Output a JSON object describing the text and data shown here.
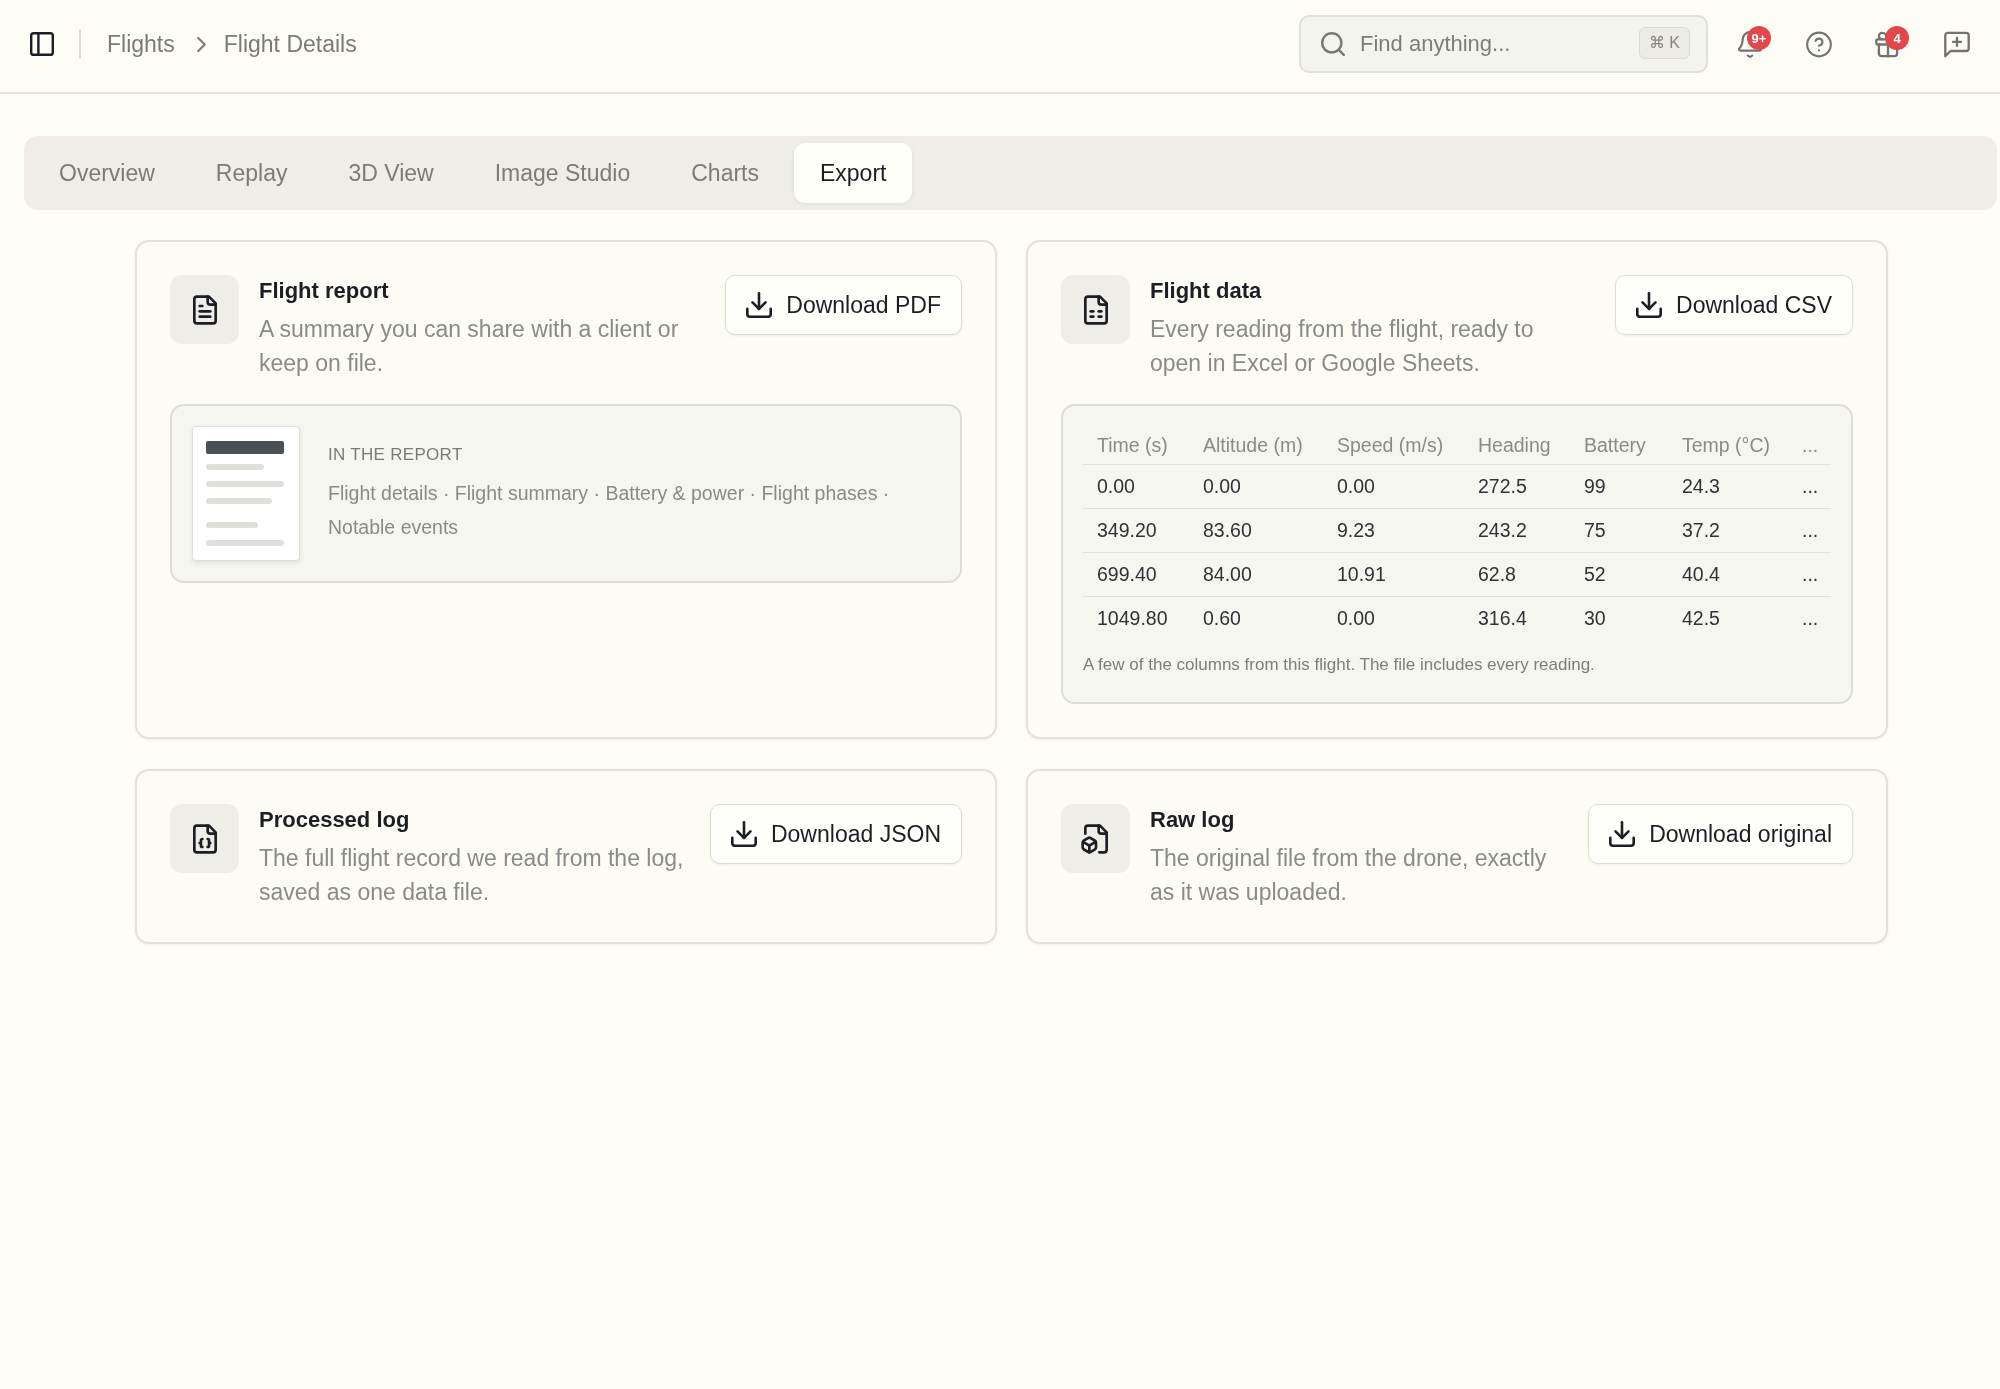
{
  "topbar": {
    "breadcrumb": [
      "Flights",
      "Flight Details"
    ],
    "search": {
      "placeholder": "Find anything...",
      "shortcut": "⌘ K"
    },
    "actions": [
      {
        "kind": "notifications",
        "badge": "9+"
      },
      {
        "kind": "help"
      },
      {
        "kind": "gifts",
        "badge": "4"
      },
      {
        "kind": "feedback"
      }
    ]
  },
  "tabs": [
    {
      "label": "Overview",
      "selected": false
    },
    {
      "label": "Replay",
      "selected": false
    },
    {
      "label": "3D View",
      "selected": false
    },
    {
      "label": "Image Studio",
      "selected": false
    },
    {
      "label": "Charts",
      "selected": false
    },
    {
      "label": "Export",
      "selected": true
    }
  ],
  "cards": [
    {
      "kind": "report",
      "title": "Flight report",
      "description": "A summary you can share with a client or keep on file.",
      "button": "Download PDF",
      "panel": {
        "heading": "IN THE REPORT",
        "contents": "Flight details · Flight summary · Battery & power · Flight phases · Notable events"
      }
    },
    {
      "kind": "data",
      "title": "Flight data",
      "description": "Every reading from the flight, ready to open in Excel or Google Sheets.",
      "button": "Download CSV",
      "table": {
        "columns": [
          "Time (s)",
          "Altitude (m)",
          "Speed (m/s)",
          "Heading",
          "Battery",
          "Temp (°C)",
          "..."
        ],
        "rows": [
          [
            "0.00",
            "0.00",
            "0.00",
            "272.5",
            "99",
            "24.3",
            "..."
          ],
          [
            "349.20",
            "83.60",
            "9.23",
            "243.2",
            "75",
            "37.2",
            "..."
          ],
          [
            "699.40",
            "84.00",
            "10.91",
            "62.8",
            "52",
            "40.4",
            "..."
          ],
          [
            "1049.80",
            "0.60",
            "0.00",
            "316.4",
            "30",
            "42.5",
            "..."
          ]
        ],
        "note": "A few of the columns from this flight. The file includes every reading."
      }
    },
    {
      "kind": "processed",
      "title": "Processed log",
      "description": "The full flight record we read from the log, saved as one data file.",
      "button": "Download JSON"
    },
    {
      "kind": "raw",
      "title": "Raw log",
      "description": "The original file from the drone, exactly as it was uploaded.",
      "button": "Download original"
    }
  ]
}
